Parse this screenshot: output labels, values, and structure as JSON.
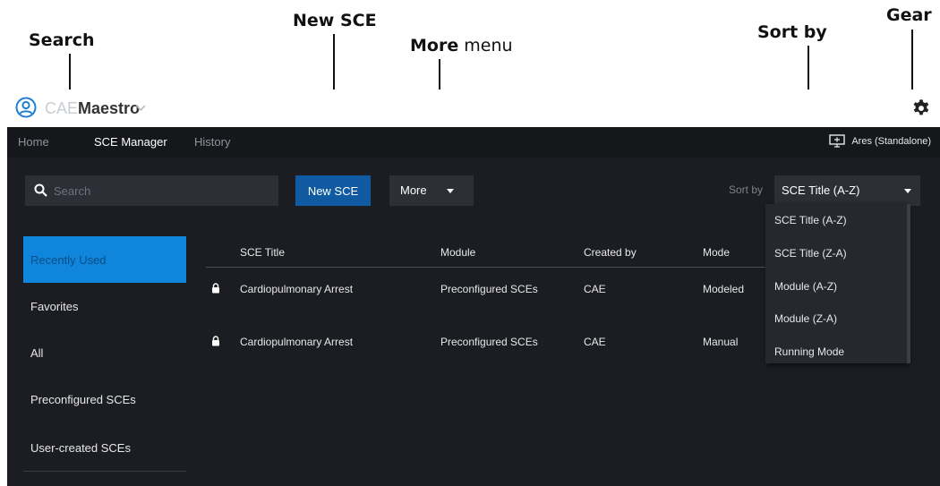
{
  "callouts": {
    "search": "Search",
    "new_sce": "New SCE",
    "more_bold": "More",
    "more_rest": " menu",
    "sort_by": "Sort by",
    "gear": "Gear"
  },
  "app": {
    "brand_light": "CAE",
    "brand_strong": "Maestro"
  },
  "nav": {
    "items": [
      "Home",
      "SCE Manager",
      "History"
    ],
    "active": "SCE Manager",
    "device": "Ares (Standalone)"
  },
  "toolbar": {
    "search_placeholder": "Search",
    "new_sce_label": "New SCE",
    "more_label": "More",
    "sort_label": "Sort by",
    "sort_value": "SCE Title (A-Z)"
  },
  "sidebar": {
    "items": [
      "Recently Used",
      "Favorites",
      "All",
      "Preconfigured SCEs",
      "User-created SCEs"
    ],
    "active": "Recently Used"
  },
  "table": {
    "headers": [
      "SCE Title",
      "Module",
      "Created by",
      "Mode"
    ],
    "rows": [
      {
        "title": "Cardiopulmonary Arrest",
        "module": "Preconfigured SCEs",
        "created_by": "CAE",
        "mode": "Modeled",
        "locked": true
      },
      {
        "title": "Cardiopulmonary Arrest",
        "module": "Preconfigured SCEs",
        "created_by": "CAE",
        "mode": "Manual",
        "locked": true
      }
    ]
  },
  "sort_options": [
    "SCE Title (A-Z)",
    "SCE Title (Z-A)",
    "Module (A-Z)",
    "Module (Z-A)",
    "Running Mode"
  ],
  "icons": {
    "brand": "user-circle-icon",
    "chevron": "chevron-down-icon",
    "gear": "gear-icon",
    "monitor": "monitor-icon",
    "search": "search-icon",
    "lock": "lock-icon",
    "caret": "caret-down-icon"
  },
  "colors": {
    "accent": "#0f86dc",
    "button_primary": "#0f5aa0",
    "background": "#1b1d22"
  }
}
